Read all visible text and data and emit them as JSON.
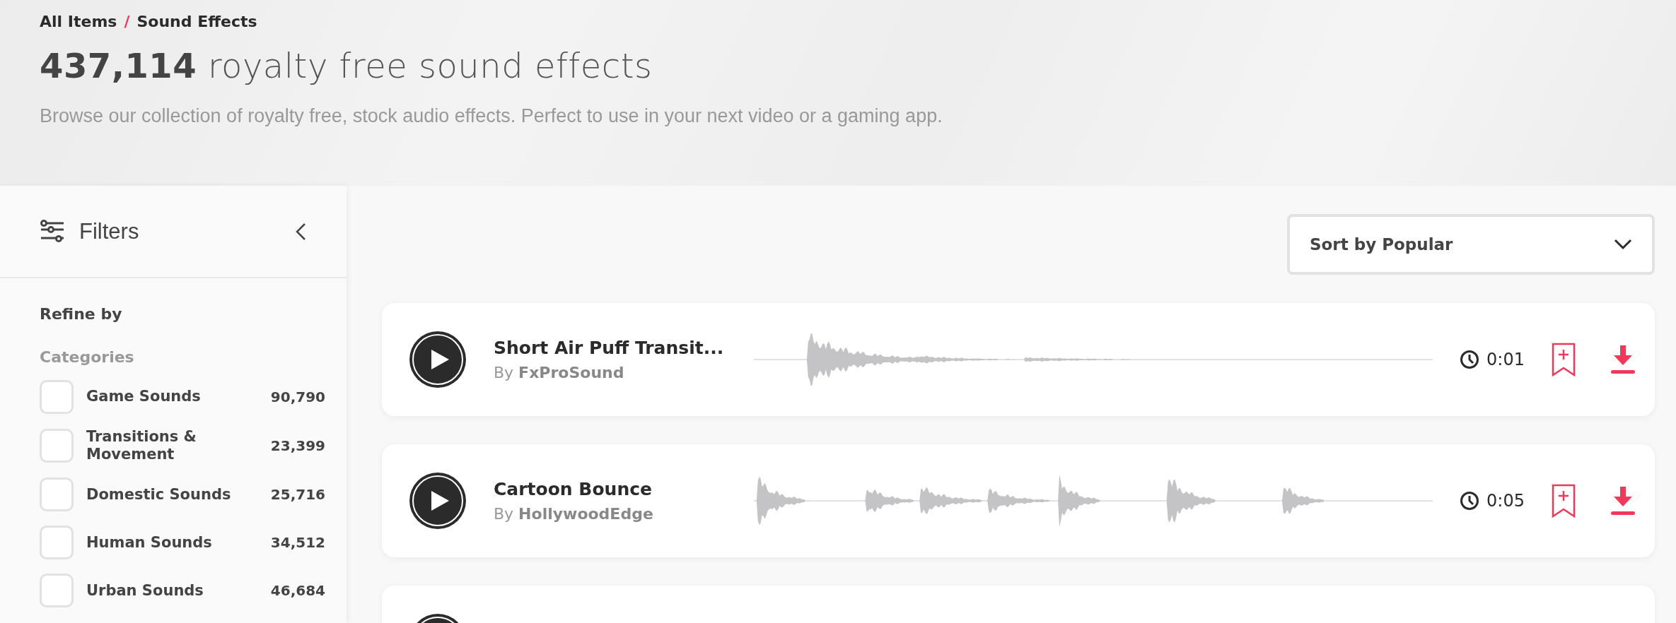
{
  "breadcrumb": [
    {
      "label": "All Items"
    },
    {
      "label": "Sound Effects"
    }
  ],
  "breadcrumb_separator": "/",
  "heading": "**437,114** royalty free sound effects",
  "description": "Browse our collection of royalty free, stock audio effects. Perfect to use in your next video or a gaming app.",
  "sidebar": {
    "title": "Filters",
    "refine_label": "Refine by",
    "section_title": "Categories",
    "categories": [
      {
        "label": "Game Sounds",
        "count": "90,790",
        "checked": false
      },
      {
        "label": "Transitions & Movement",
        "count": "23,399",
        "checked": false
      },
      {
        "label": "Domestic Sounds",
        "count": "25,716",
        "checked": false
      },
      {
        "label": "Human Sounds",
        "count": "34,512",
        "checked": false
      },
      {
        "label": "Urban Sounds",
        "count": "46,684",
        "checked": false
      }
    ]
  },
  "sort": {
    "value": "Sort by Popular"
  },
  "tracks": [
    {
      "kind": "full",
      "title": "Short Air Puff Transit...",
      "byline": "By **FxProSound**",
      "duration": "0:01"
    },
    {
      "kind": "full",
      "title": "Cartoon Bounce",
      "byline": "By **HollywoodEdge**",
      "duration": "0:05"
    },
    {
      "kind": "cut_off"
    }
  ]
}
